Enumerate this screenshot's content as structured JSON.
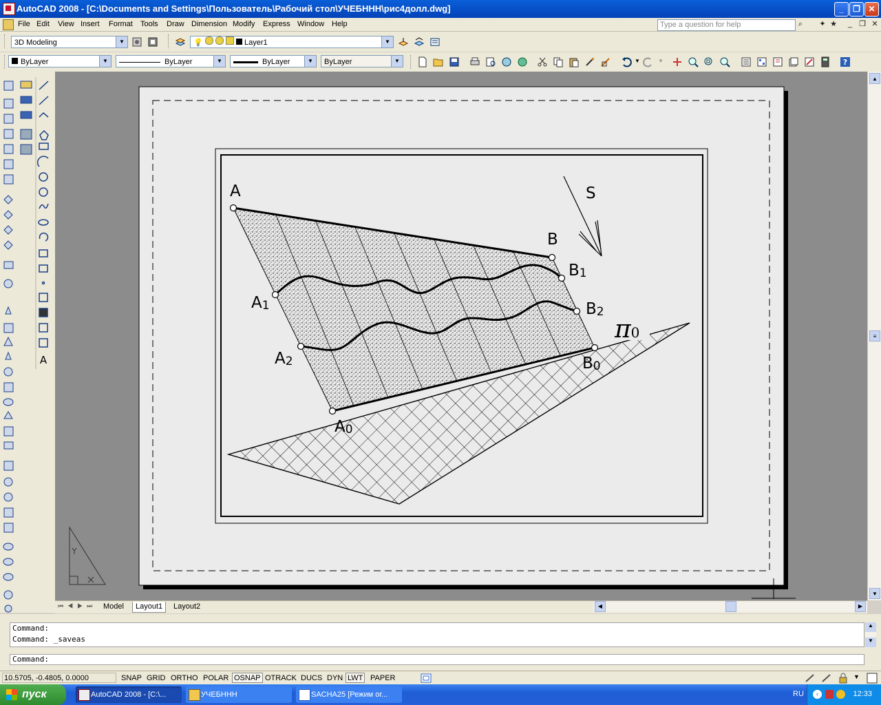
{
  "window": {
    "title": "AutoCAD 2008 - [C:\\Documents and Settings\\Пользователь\\Рабочий стол\\УЧЕБННН\\рис4долл.dwg]",
    "controls": [
      "_",
      "❐",
      "✕"
    ]
  },
  "menu": {
    "items": [
      "File",
      "Edit",
      "View",
      "Insert",
      "Format",
      "Tools",
      "Draw",
      "Dimension",
      "Modify",
      "Express",
      "Window",
      "Help"
    ],
    "help_placeholder": "Type a question for help"
  },
  "toolbar": {
    "workspace": "3D Modeling",
    "layer": "Layer1",
    "color": "ByLayer",
    "linetype": "ByLayer",
    "lineweight": "ByLayer",
    "plotstyle": "ByLayer"
  },
  "drawing": {
    "labels": {
      "A": "A",
      "B": "B",
      "S": "S",
      "A1": "A",
      "A1sub": "1",
      "B1": "B",
      "B1sub": "1",
      "A2": "A",
      "A2sub": "2",
      "B2": "B",
      "B2sub": "2",
      "A0": "A",
      "A0sub": "0",
      "B0": "B",
      "B0sub": "0",
      "pi": "π",
      "pisub": "0"
    }
  },
  "tabs": [
    "Model",
    "Layout1",
    "Layout2"
  ],
  "command": {
    "history": [
      "Command:",
      "Command:  _saveas"
    ],
    "prompt": "Command:"
  },
  "status": {
    "coords": "10.5705, -0.4805, 0.0000",
    "buttons": [
      {
        "label": "SNAP",
        "on": false
      },
      {
        "label": "GRID",
        "on": false
      },
      {
        "label": "ORTHO",
        "on": false
      },
      {
        "label": "POLAR",
        "on": false
      },
      {
        "label": "OSNAP",
        "on": true
      },
      {
        "label": "OTRACK",
        "on": false
      },
      {
        "label": "DUCS",
        "on": false
      },
      {
        "label": "DYN",
        "on": false
      },
      {
        "label": "LWT",
        "on": true
      },
      {
        "label": "PAPER",
        "on": false
      }
    ]
  },
  "taskbar": {
    "start": "пуск",
    "tasks": [
      "AutoCAD 2008 - [C:\\...",
      "УЧЕБННН",
      "SACHA25 [Режим ог..."
    ],
    "lang": "RU",
    "clock": "12:33"
  },
  "colors": {
    "titlebar": "#0a5fd8",
    "drawing_bg": "#8c8c8c",
    "paper": "#ebebeb",
    "taskbar": "#2460d8",
    "start": "#3a9a3a"
  }
}
